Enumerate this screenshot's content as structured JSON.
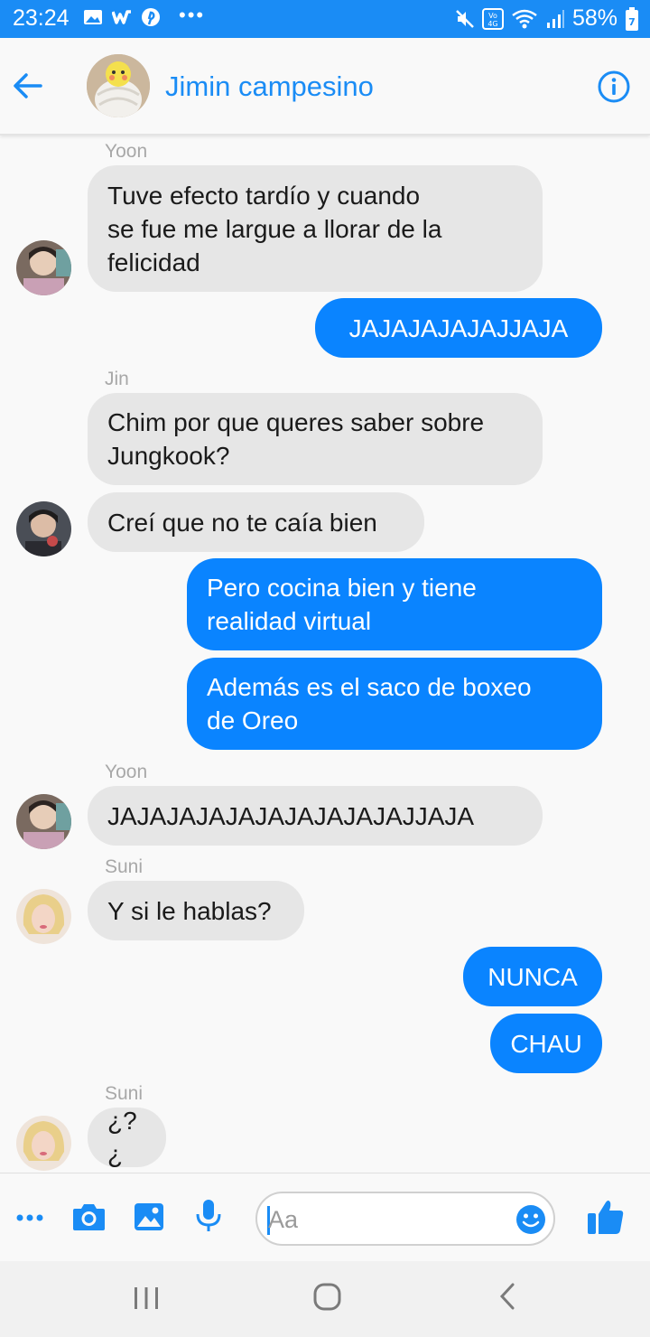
{
  "status_bar": {
    "time": "23:24",
    "battery": "58%",
    "network": "Vo) 4G",
    "battery_level": "7",
    "icons": [
      "gallery-icon",
      "wattpad-icon",
      "pinterest-icon",
      "more-icon",
      "mute-icon",
      "wifi-icon",
      "signal-icon",
      "battery-icon"
    ]
  },
  "header": {
    "title": "Jimin campesino",
    "back_icon": "back-arrow-icon",
    "info_icon": "info-icon"
  },
  "messages": [
    {
      "sender": "Yoon",
      "direction": "in",
      "text_lines": [
        "Tuve efecto tardío y cuando",
        "se fue me largue a llorar de la",
        "felicidad"
      ]
    },
    {
      "direction": "out",
      "text_lines": [
        "JAJAJAJAJAJJAJA"
      ]
    },
    {
      "sender": "Jin",
      "direction": "in",
      "text_lines": [
        "Chim por que queres saber sobre",
        "Jungkook?"
      ]
    },
    {
      "direction": "in",
      "text_lines": [
        "Creí que no te caía bien"
      ]
    },
    {
      "direction": "out",
      "text_lines": [
        "Pero cocina bien y tiene",
        "realidad virtual"
      ]
    },
    {
      "direction": "out",
      "text_lines": [
        "Además es el saco de boxeo",
        "de Oreo"
      ]
    },
    {
      "sender": "Yoon",
      "direction": "in",
      "text_lines": [
        "JAJAJAJAJAJAJAJAJAJAJJAJA"
      ]
    },
    {
      "sender": "Suni",
      "direction": "in",
      "text_lines": [
        "Y si le hablas?"
      ]
    },
    {
      "direction": "out",
      "text_lines": [
        "NUNCA"
      ]
    },
    {
      "direction": "out",
      "text_lines": [
        "CHAU"
      ]
    },
    {
      "sender": "Suni",
      "direction": "in",
      "text_lines": [
        "¿?¿"
      ]
    }
  ],
  "composer": {
    "placeholder": "Aa",
    "value": "",
    "icons": [
      "more-icon",
      "camera-icon",
      "image-icon",
      "microphone-icon",
      "emoji-icon",
      "thumbs-up-icon"
    ]
  },
  "colors": {
    "accent": "#1a8cf5",
    "outgoing_bubble": "#0a84ff",
    "incoming_bubble": "#e6e6e6",
    "background": "#f9f9f9"
  }
}
